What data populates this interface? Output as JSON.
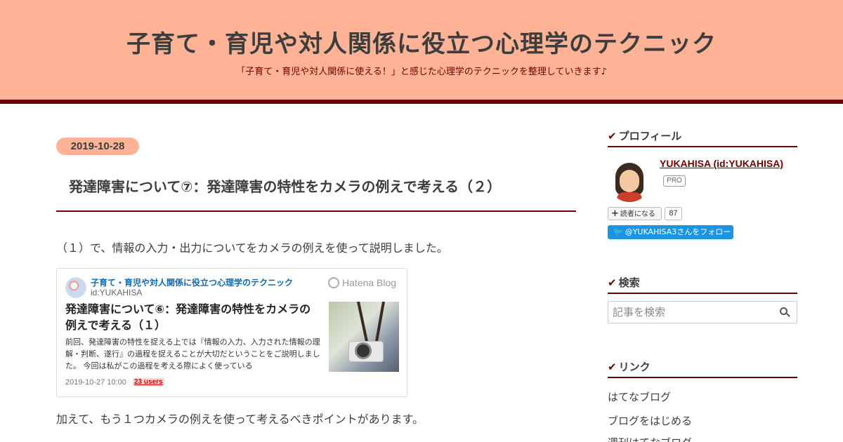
{
  "header": {
    "title": "子育て・育児や対人関係に役立つ心理学のテクニック",
    "description": "「子育て・育児や対人関係に使える！」と感じた心理学のテクニックを整理していきます♪"
  },
  "entry": {
    "date": "2019-10-28",
    "title": "発達障害について⑦：発達障害の特性をカメラの例えで考える（２）",
    "paragraph1": "（１）で、情報の入力・出力についてをカメラの例えを使って説明しました。",
    "paragraph2": "加えて、もう１つカメラの例えを使って考えるべきポイントがあります。"
  },
  "embed_card": {
    "blog_name": "子育て・育児や対人関係に役立つ心理学のテクニック",
    "blog_id": "id:YUKAHISA",
    "brand": "Hatena Blog",
    "title": "発達障害について⑥：発達障害の特性をカメラの例えで考える（１）",
    "excerpt": "前回、発達障害の特性を捉える上では『情報の入力、入力された情報の理解・判断、遂行』の過程を捉えることが大切だということをご説明しました。 今回は私がこの過程を考える際によく使っている",
    "timestamp": "2019-10-27 10:00",
    "users": "23 users"
  },
  "sidebar": {
    "profile": {
      "heading": "プロフィール",
      "name": "YUKAHISA (id:YUKAHISA)",
      "badge": "PRO",
      "reader_button": "読者になる",
      "reader_count": "87",
      "follow_button": "@YUKAHISA3さんをフォロー"
    },
    "search": {
      "heading": "検索",
      "placeholder": "記事を検索"
    },
    "links": {
      "heading": "リンク",
      "items": [
        "はてなブログ",
        "ブログをはじめる",
        "週刊はてなブログ"
      ]
    }
  },
  "colors": {
    "header_bg": "#feb396",
    "accent": "#6e0000",
    "link_blue": "#0c6ab0",
    "twitter_blue": "#1b95e0"
  },
  "icons": {
    "heading_marker": "check-icon",
    "search": "search-icon",
    "twitter": "bird-icon",
    "hatena": "hatena-logo-icon"
  }
}
